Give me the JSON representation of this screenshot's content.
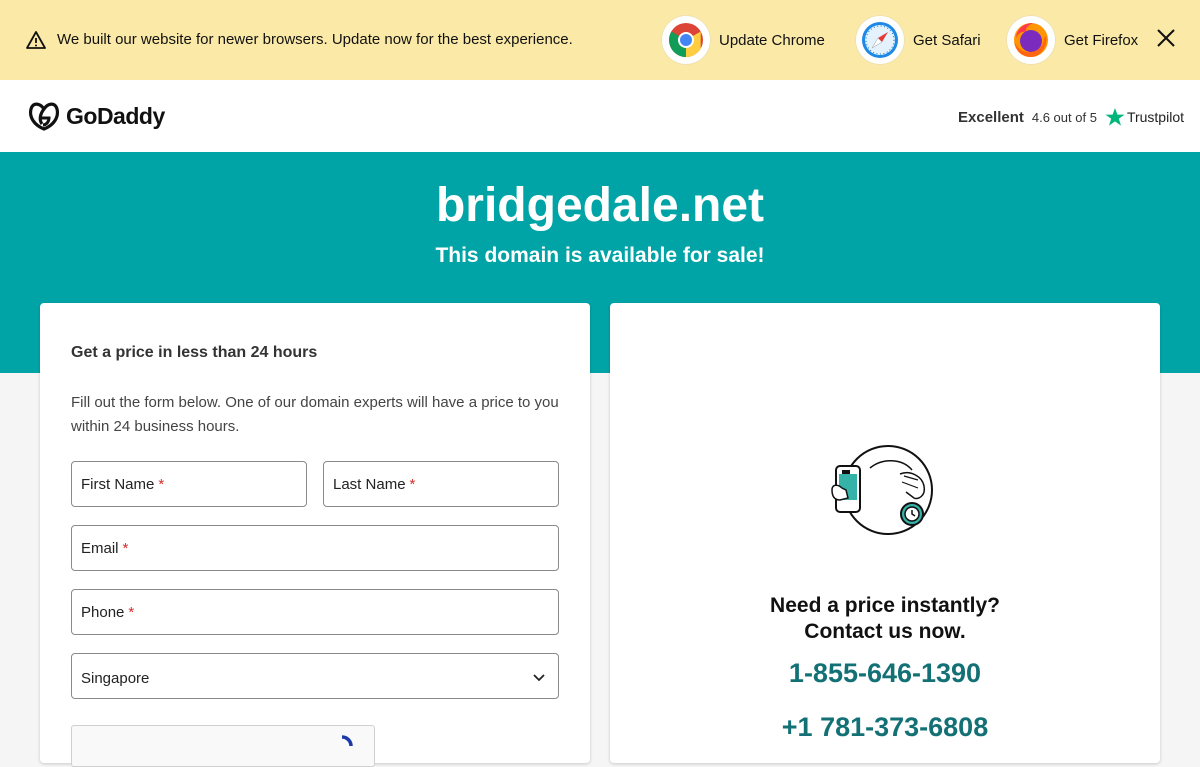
{
  "banner": {
    "message": "We built our website for newer browsers. Update now for the best experience.",
    "browsers": [
      {
        "label": "Update Chrome",
        "icon": "chrome-icon"
      },
      {
        "label": "Get Safari",
        "icon": "safari-icon"
      },
      {
        "label": "Get Firefox",
        "icon": "firefox-icon"
      }
    ],
    "close_icon": "close-icon"
  },
  "header": {
    "brand": "GoDaddy",
    "rating_word": "Excellent",
    "rating_score": "4.6 out of 5",
    "trustpilot": "Trustpilot"
  },
  "hero": {
    "domain": "bridgedale.net",
    "subtitle": "This domain is available for sale!"
  },
  "form": {
    "title": "Get a price in less than 24 hours",
    "description": "Fill out the form below. One of our domain experts will have a price to you within 24 business hours.",
    "first_name": "First Name",
    "last_name": "Last Name",
    "email": "Email",
    "phone": "Phone",
    "required_mark": "*",
    "country": "Singapore"
  },
  "contact": {
    "cta_line1": "Need a price instantly?",
    "cta_line2": "Contact us now.",
    "phone1": "1-855-646-1390",
    "phone2": "+1 781-373-6808"
  },
  "colors": {
    "banner_bg": "#fbeaa7",
    "hero_bg": "#00a4a6",
    "phone_text": "#137176",
    "trustpilot_star": "#00b67a",
    "required": "#d92b2b"
  }
}
